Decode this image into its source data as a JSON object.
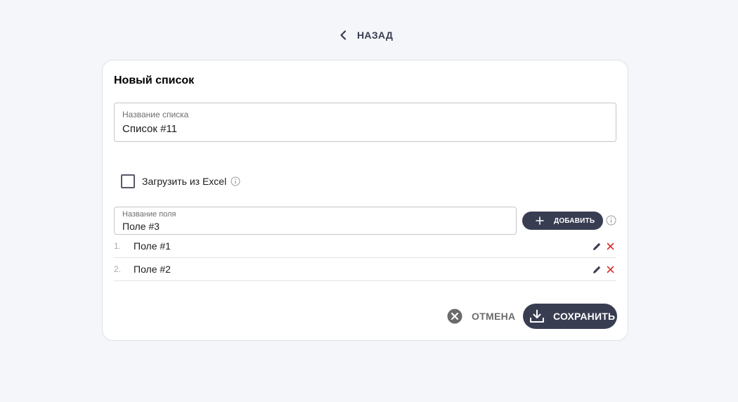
{
  "nav": {
    "back_label": "НАЗАД"
  },
  "form": {
    "title": "Новый список",
    "list_name": {
      "label": "Название списка",
      "value": "Список #11"
    },
    "excel": {
      "label": "Загрузить из Excel",
      "checked": false
    },
    "field_name": {
      "label": "Название поля",
      "value": "Поле #3"
    },
    "add_label": "ДОБАВИТЬ",
    "fields": [
      {
        "num": "1.",
        "name": "Поле #1"
      },
      {
        "num": "2.",
        "name": "Поле #2"
      }
    ],
    "cancel_label": "ОТМЕНА",
    "save_label": "СОХРАНИТЬ"
  },
  "icons": {
    "back": "chevron-left-icon",
    "info": "info-icon",
    "add": "plus-icon",
    "edit": "pencil-icon",
    "delete": "close-icon",
    "cancel": "cancel-circle-icon",
    "save": "download-icon"
  },
  "colors": {
    "primary": "#383d52",
    "danger": "#d32f2f",
    "background": "#f5f6f9"
  }
}
